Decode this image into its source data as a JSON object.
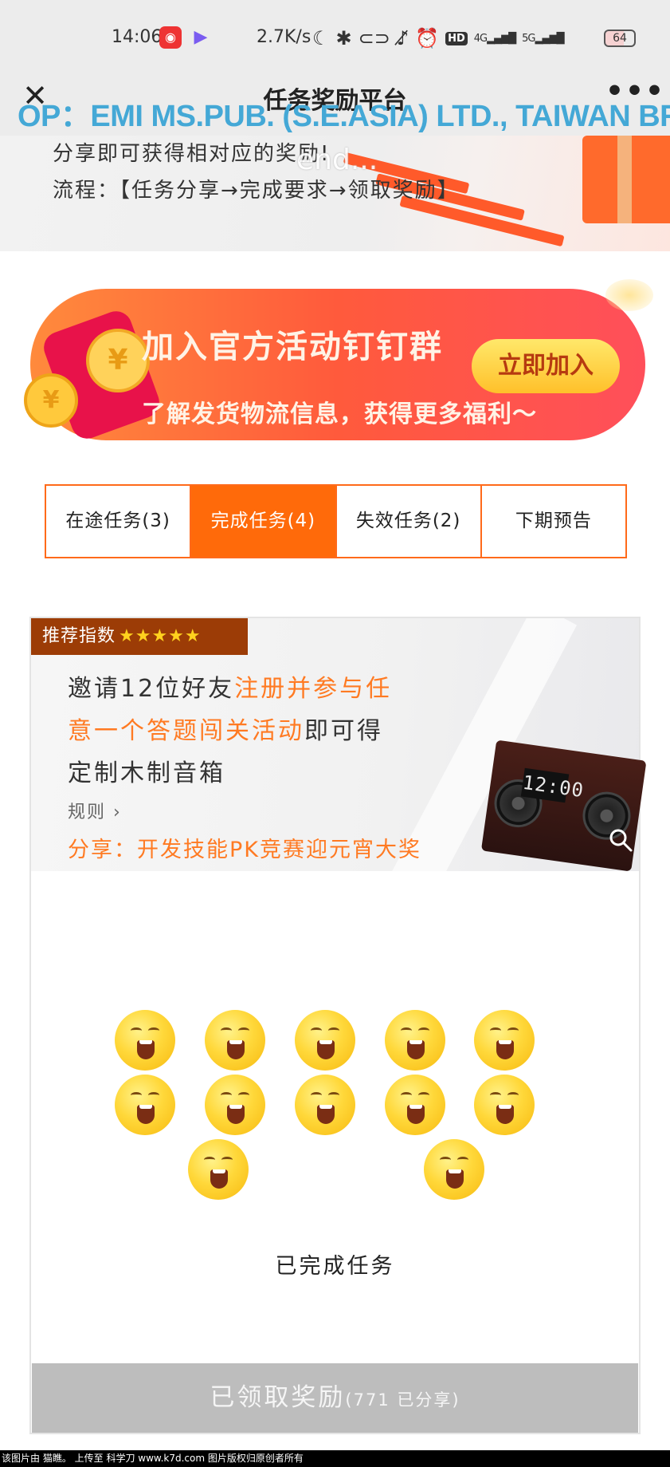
{
  "status_bar": {
    "time": "14:06",
    "net_speed": "2.7K/s",
    "battery": "64",
    "signal_4g": "4G",
    "signal_5g": "5G",
    "hd_label": "HD"
  },
  "header": {
    "title": "任务奖励平台",
    "close_icon": "close-icon",
    "more_icon": "more-icon",
    "overlay_banner": "OP：EMI MS.PUB. (S.E.ASIA) LTD., TAIWAN BR"
  },
  "intro": {
    "line1": "分享即可获得相对应的奖励!",
    "line2": "流程：【任务分享→完成要求→领取奖励】",
    "overlay_end": "end..."
  },
  "dingtalk_banner": {
    "title": "加入官方活动钉钉群",
    "subtitle": "了解发货物流信息，获得更多福利～",
    "button": "立即加入",
    "coin_symbol": "¥"
  },
  "tabs": [
    {
      "label": "在途任务(3)",
      "active": false
    },
    {
      "label": "完成任务(4)",
      "active": true
    },
    {
      "label": "失效任务(2)",
      "active": false
    },
    {
      "label": "下期预告",
      "active": false
    }
  ],
  "task_card": {
    "badge": "推荐指数",
    "stars": "★★★★★",
    "rating": 5,
    "desc_line1_a": "邀请12位好友",
    "desc_line1_b": "注册并参与任",
    "desc_line2_a": "意一个答题闯关活动",
    "desc_line2_b": "即可得",
    "desc_line3": "定制木制音箱",
    "rules": "规则",
    "share": "分享：开发技能PK竞赛迎元宵大奖",
    "speaker_display": "12:00",
    "completed_label": "已完成任务",
    "emoji_count": 12
  },
  "claim_button": {
    "label": "已领取奖励",
    "sub": "(771 已分享)"
  },
  "footer": {
    "text": "该图片由 猫瞧。 上传至 科学刀 www.k7d.com 图片版权归原创者所有"
  },
  "colors": {
    "accent": "#ff6a0a",
    "overlay_text": "#44a8d6",
    "badge_bg": "#9c3c06",
    "claim_bg": "#bdbdbd"
  }
}
